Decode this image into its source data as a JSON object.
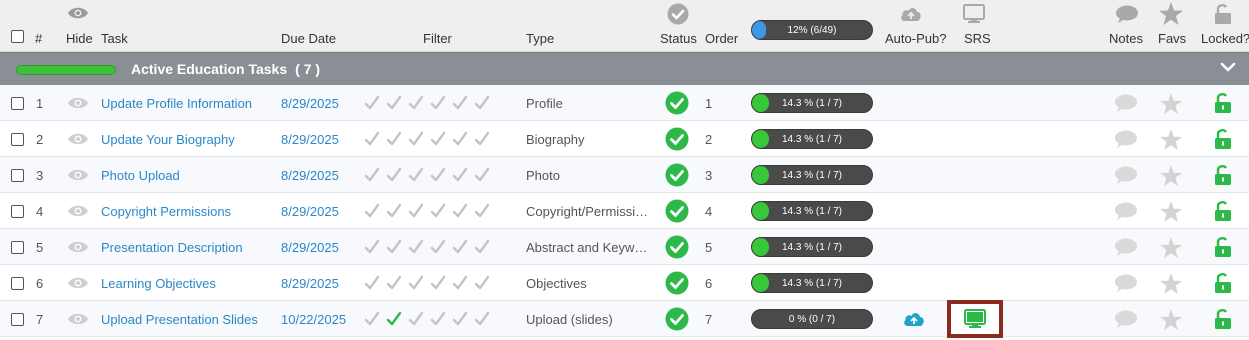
{
  "header": {
    "cols": {
      "number": "#",
      "hide": "Hide",
      "task": "Task",
      "due_date": "Due Date",
      "filter": "Filter",
      "type": "Type",
      "status": "Status",
      "order": "Order",
      "auto_pub": "Auto-Pub?",
      "srs": "SRS",
      "notes": "Notes",
      "favs": "Favs",
      "locked": "Locked?"
    },
    "progress": {
      "label": "12% (6/49)",
      "fraction": 0.12
    }
  },
  "group": {
    "title": "Active Education Tasks",
    "count": "( 7 )",
    "progress_fraction": 1.0
  },
  "rows": [
    {
      "num": "1",
      "task": "Update Profile Information",
      "due": "8/29/2025",
      "filters_checked": [
        false,
        false,
        false,
        false,
        false,
        false
      ],
      "type": "Profile",
      "order": "1",
      "progress_label": "14.3 % (1 / 7)",
      "progress_fraction": 0.143,
      "auto_pub": false,
      "srs": false
    },
    {
      "num": "2",
      "task": "Update Your Biography",
      "due": "8/29/2025",
      "filters_checked": [
        false,
        false,
        false,
        false,
        false,
        false
      ],
      "type": "Biography",
      "order": "2",
      "progress_label": "14.3 % (1 / 7)",
      "progress_fraction": 0.143,
      "auto_pub": false,
      "srs": false
    },
    {
      "num": "3",
      "task": "Photo Upload",
      "due": "8/29/2025",
      "filters_checked": [
        false,
        false,
        false,
        false,
        false,
        false
      ],
      "type": "Photo",
      "order": "3",
      "progress_label": "14.3 % (1 / 7)",
      "progress_fraction": 0.143,
      "auto_pub": false,
      "srs": false
    },
    {
      "num": "4",
      "task": "Copyright Permissions",
      "due": "8/29/2025",
      "filters_checked": [
        false,
        false,
        false,
        false,
        false,
        false
      ],
      "type": "Copyright/Permissio...",
      "order": "4",
      "progress_label": "14.3 % (1 / 7)",
      "progress_fraction": 0.143,
      "auto_pub": false,
      "srs": false
    },
    {
      "num": "5",
      "task": "Presentation Description",
      "due": "8/29/2025",
      "filters_checked": [
        false,
        false,
        false,
        false,
        false,
        false
      ],
      "type": "Abstract and Keywo...",
      "order": "5",
      "progress_label": "14.3 % (1 / 7)",
      "progress_fraction": 0.143,
      "auto_pub": false,
      "srs": false
    },
    {
      "num": "6",
      "task": "Learning Objectives",
      "due": "8/29/2025",
      "filters_checked": [
        false,
        false,
        false,
        false,
        false,
        false
      ],
      "type": "Objectives",
      "order": "6",
      "progress_label": "14.3 % (1 / 7)",
      "progress_fraction": 0.143,
      "auto_pub": false,
      "srs": false
    },
    {
      "num": "7",
      "task": "Upload Presentation Slides",
      "due": "10/22/2025",
      "filters_checked": [
        false,
        true,
        false,
        false,
        false,
        false
      ],
      "type": "Upload (slides)",
      "order": "7",
      "progress_label": "0 % (0 / 7)",
      "progress_fraction": 0.0,
      "auto_pub": true,
      "srs": true
    }
  ],
  "colors": {
    "header_bg": "#efefef",
    "group_bar": "#8a8f96",
    "link": "#2a88c8",
    "status_green": "#2db84a",
    "progress_green": "#38c738",
    "progress_blue": "#3c97e6",
    "lock_green": "#2db84a",
    "cloud_teal": "#1fa3c9",
    "srs_border": "#8b2a1d"
  }
}
